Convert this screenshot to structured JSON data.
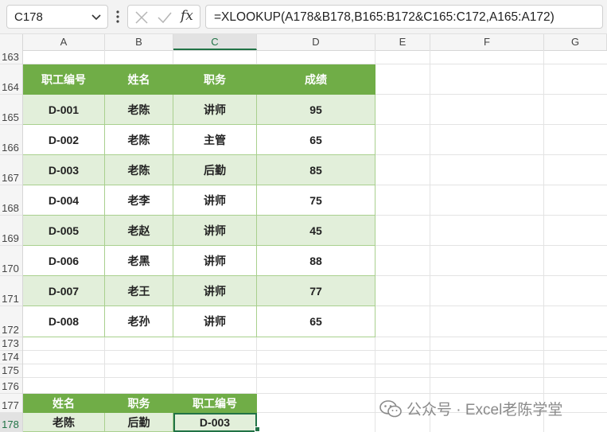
{
  "formula_bar": {
    "name_box": "C178",
    "fx_label": "fx",
    "formula": "=XLOOKUP(A178&B178,B165:B172&C165:C172,A165:A172)"
  },
  "columns": [
    "A",
    "B",
    "C",
    "D",
    "E",
    "F",
    "G"
  ],
  "selected_column": "C",
  "rows": [
    "163",
    "164",
    "165",
    "166",
    "167",
    "168",
    "169",
    "170",
    "171",
    "172",
    "173",
    "174",
    "175",
    "176",
    "177",
    "178"
  ],
  "selected_row": "178",
  "table": {
    "headers": [
      "职工编号",
      "姓名",
      "职务",
      "成绩"
    ],
    "rows": [
      [
        "D-001",
        "老陈",
        "讲师",
        "95"
      ],
      [
        "D-002",
        "老陈",
        "主管",
        "65"
      ],
      [
        "D-003",
        "老陈",
        "后勤",
        "85"
      ],
      [
        "D-004",
        "老李",
        "讲师",
        "75"
      ],
      [
        "D-005",
        "老赵",
        "讲师",
        "45"
      ],
      [
        "D-006",
        "老黑",
        "讲师",
        "88"
      ],
      [
        "D-007",
        "老王",
        "讲师",
        "77"
      ],
      [
        "D-008",
        "老孙",
        "讲师",
        "65"
      ]
    ]
  },
  "lookup": {
    "headers": [
      "姓名",
      "职务",
      "职工编号"
    ],
    "values": [
      "老陈",
      "后勤",
      "D-003"
    ]
  },
  "watermark": "公众号 · Excel老陈学堂",
  "colors": {
    "header_green": "#70ad47",
    "band_green": "#e2efda",
    "selection_green": "#217346"
  }
}
